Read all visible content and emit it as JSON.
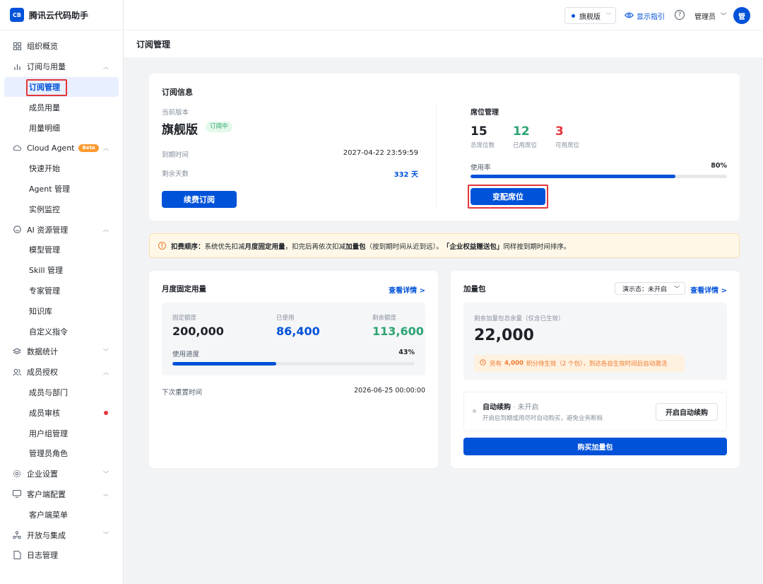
{
  "brand": {
    "logo": "CB",
    "name": "腾讯云代码助手"
  },
  "topbar": {
    "edition": "旗舰版",
    "guide": "显示指引",
    "help": "?",
    "admin": "管理员",
    "avatar": "管"
  },
  "sidebar": {
    "groups": [
      {
        "label": "组织概览",
        "icon": "grid-icon"
      },
      {
        "label": "订阅与用量",
        "icon": "bar-chart-icon",
        "items": [
          "订阅管理",
          "成员用量",
          "用量明细"
        ]
      },
      {
        "label": "Cloud Agent",
        "badge": "Beta",
        "icon": "cloud-icon",
        "items": [
          "快速开始",
          "Agent 管理",
          "实例监控"
        ]
      },
      {
        "label": "AI 资源管理",
        "icon": "smile-icon",
        "items": [
          "模型管理",
          "Skill 管理",
          "专家管理",
          "知识库",
          "自定义指令"
        ]
      },
      {
        "label": "数据统计",
        "icon": "layers-icon"
      },
      {
        "label": "成员授权",
        "icon": "users-icon",
        "items": [
          "成员与部门",
          "成员审核",
          "用户组管理",
          "管理员角色"
        ]
      },
      {
        "label": "企业设置",
        "icon": "gear-icon"
      },
      {
        "label": "客户端配置",
        "icon": "monitor-icon",
        "items": [
          "客户端菜单"
        ]
      },
      {
        "label": "开放与集成",
        "icon": "integration-icon"
      },
      {
        "label": "日志管理",
        "icon": "log-icon"
      }
    ]
  },
  "page": {
    "title": "订阅管理"
  },
  "subscription": {
    "title": "订阅信息",
    "version_label": "当前版本",
    "version": "旗舰版",
    "status": "订阅中",
    "expire_label": "到期时间",
    "expire_value": "2027-04-22 23:59:59",
    "remain_label": "剩余天数",
    "remain_value": "332 天",
    "renew_button": "续费订阅"
  },
  "seats": {
    "title": "席位管理",
    "total": "15",
    "total_label": "总席位数",
    "used": "12",
    "used_label": "已用席位",
    "available": "3",
    "available_label": "可用席位",
    "usage_label": "使用率",
    "usage_text": "80%",
    "usage_fraction": 0.8,
    "change_button": "变配席位"
  },
  "notice": {
    "prefix": "扣费顺序：",
    "t1": "系统优先扣减",
    "b1": "月度固定用量",
    "t2": "，扣完后再依次扣减",
    "b2": "加量包",
    "t3": "（按到期时间从近到远）。",
    "b3": "「企业权益赠送包」",
    "t4": "同样按到期时间排序。"
  },
  "monthly": {
    "title": "月度固定用量",
    "link": "查看详情 >",
    "fixed_label": "固定额度",
    "fixed_value": "200,000",
    "used_label": "已使用",
    "used_value": "86,400",
    "remain_label": "剩余额度",
    "remain_value": "113,600",
    "progress_label": "使用进度",
    "progress_text": "43%",
    "progress_fraction": 0.43,
    "reset_label": "下次重置时间",
    "reset_value": "2026-06-25 00:00:00"
  },
  "addon": {
    "title": "加量包",
    "demo_state": "演示态：未开启",
    "link": "查看详情 >",
    "remain_label": "剩余加量包总余量（仅含已生效）",
    "remain_value": "22,000",
    "pending_prefix": "另有",
    "pending_points": "4,000",
    "pending_suffix": "积分待生效（2 个包），到达各自生效时间后自动激活",
    "auto_title": "自动续购",
    "auto_state": " · 未开启",
    "auto_desc": "开启后到期或用尽时自动购买，避免业务断档",
    "auto_button": "开启自动续购",
    "buy_button": "购买加量包"
  },
  "colors": {
    "primary": "#0052d9",
    "success": "#2ba471",
    "danger": "#e5353b",
    "warning": "#ed7b2f"
  }
}
